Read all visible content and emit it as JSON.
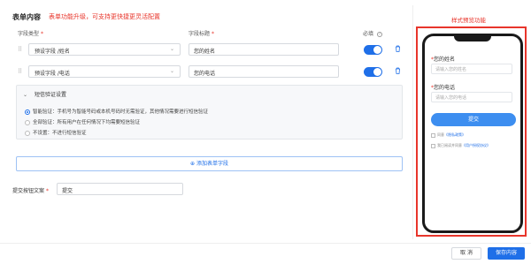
{
  "header": {
    "title": "表单内容",
    "note": "表单功能升级，可支持更快捷更灵活配置"
  },
  "columns": {
    "type": "字段类型",
    "title": "字段标题",
    "required": "必填",
    "required_mark": "*"
  },
  "fields": [
    {
      "handle": "⠿",
      "type": "预设字段 /姓名",
      "title": "您的姓名",
      "required": true
    },
    {
      "handle": "⠿",
      "type": "预设字段 /电话",
      "title": "您的电话",
      "required": true
    }
  ],
  "sms": {
    "header": "短信验证设置",
    "options": [
      {
        "label": "智能验证：手机号为智能号码或本机号码时无需验证，其他情况需要进行短信验证",
        "selected": true
      },
      {
        "label": "全部验证：所有用户在任何情况下均需要短信验证",
        "selected": false
      },
      {
        "label": "不设置：不进行短信验证",
        "selected": false
      }
    ]
  },
  "add_field": {
    "icon": "⊕",
    "label": "添加表单字段"
  },
  "submit": {
    "label": "提交按钮文案",
    "required_mark": "*",
    "value": "提交"
  },
  "preview": {
    "title": "样式预览功能",
    "fields": [
      {
        "label": "您的姓名",
        "placeholder": "请输入您的姓名"
      },
      {
        "label": "您的电话",
        "placeholder": "请输入您的电话"
      }
    ],
    "submit": "提交",
    "checks": [
      {
        "text": "同意",
        "link": "《隐私政策》"
      },
      {
        "text": "我已阅读并同意",
        "link": "《用户授权协议》"
      }
    ]
  },
  "footer": {
    "cancel": "取 消",
    "save": "保存内容"
  },
  "colors": {
    "accent": "#1f6fe8",
    "annotation": "#e8352b"
  }
}
